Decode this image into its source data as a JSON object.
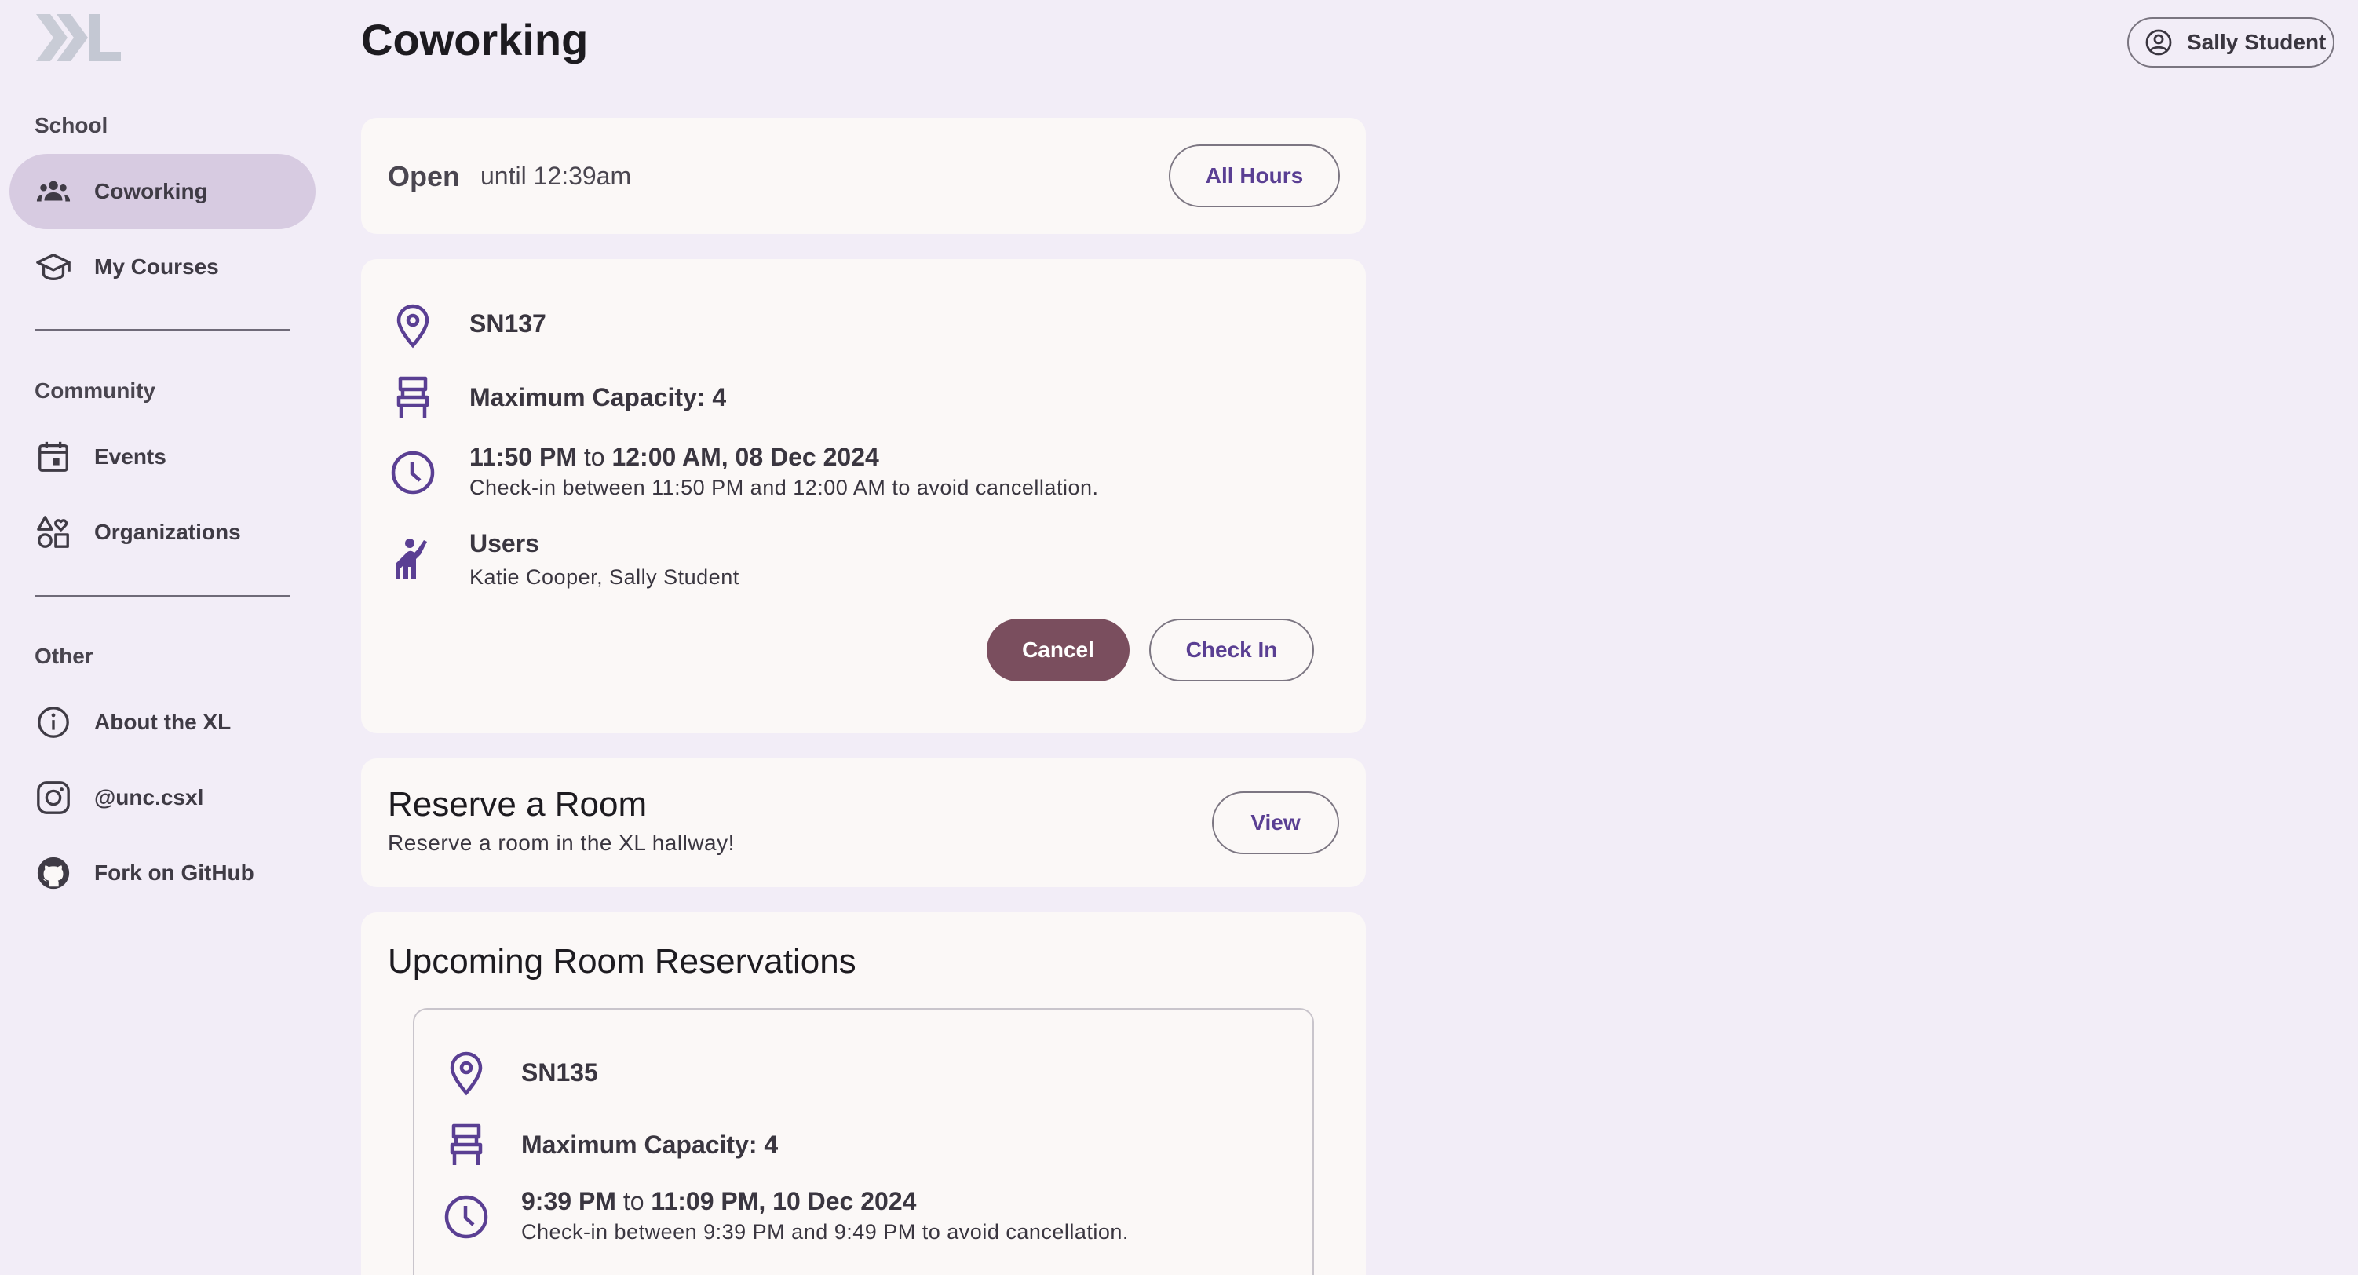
{
  "sidebar": {
    "logo": "XL",
    "sections": [
      {
        "label": "School",
        "items": [
          {
            "label": "Coworking",
            "icon": "people-icon",
            "active": true
          },
          {
            "label": "My Courses",
            "icon": "school-icon",
            "active": false
          }
        ]
      },
      {
        "label": "Community",
        "items": [
          {
            "label": "Events",
            "icon": "calendar-icon",
            "active": false
          },
          {
            "label": "Organizations",
            "icon": "shapes-icon",
            "active": false
          }
        ]
      },
      {
        "label": "Other",
        "items": [
          {
            "label": "About the XL",
            "icon": "info-icon",
            "active": false
          },
          {
            "label": "@unc.csxl",
            "icon": "instagram-icon",
            "active": false
          },
          {
            "label": "Fork on GitHub",
            "icon": "github-icon",
            "active": false
          }
        ]
      }
    ]
  },
  "header": {
    "title": "Coworking",
    "user_name": "Sally Student"
  },
  "status_card": {
    "status": "Open",
    "until": "until 12:39am",
    "button_label": "All Hours"
  },
  "reservation_card": {
    "room": "SN137",
    "capacity": "Maximum Capacity: 4",
    "start": "11:50 PM",
    "to": "to",
    "end": "12:00 AM, 08 Dec 2024",
    "checkin_note": "Check-in between 11:50 PM and 12:00 AM to avoid cancellation.",
    "users_label": "Users",
    "users": "Katie Cooper, Sally Student",
    "cancel_label": "Cancel",
    "checkin_label": "Check In"
  },
  "reserve_card": {
    "title": "Reserve a Room",
    "subtitle": "Reserve a room in the XL hallway!",
    "button_label": "View"
  },
  "upcoming_card": {
    "title": "Upcoming Room Reservations",
    "room": "SN135",
    "capacity": "Maximum Capacity: 4",
    "start": "9:39 PM",
    "to": "to",
    "end": "11:09 PM, 10 Dec 2024",
    "checkin_note": "Check-in between 9:39 PM and 9:49 PM to avoid cancellation."
  },
  "colors": {
    "background": "#f2edf7",
    "card": "#fbf8f7",
    "accent": "#5a3f93",
    "active_nav": "#d7cbe1",
    "cancel": "#7a4e5e"
  }
}
